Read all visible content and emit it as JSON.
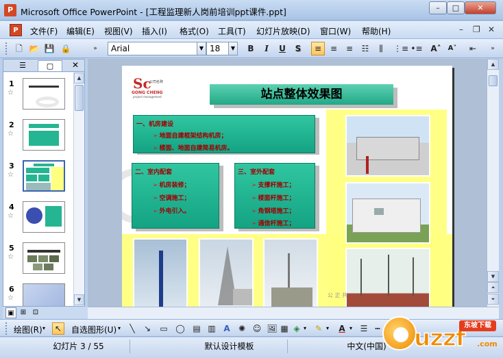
{
  "window": {
    "title": "Microsoft Office PowerPoint - [工程监理新人岗前培训ppt课件.ppt]",
    "min": "–",
    "max": "□",
    "close": "✕"
  },
  "menu": {
    "items": [
      "文件(F)",
      "编辑(E)",
      "视图(V)",
      "插入(I)",
      "格式(O)",
      "工具(T)",
      "幻灯片放映(D)",
      "窗口(W)",
      "帮助(H)"
    ],
    "ctrl_min": "–",
    "ctrl_restore": "❐",
    "ctrl_close": "✕"
  },
  "toolbar": {
    "font_name": "Arial",
    "font_size": "18",
    "bold": "B",
    "italic": "I",
    "underline": "U",
    "shadow": "S",
    "grow": "A˄",
    "shrink": "A˅"
  },
  "pane": {
    "tab_outline": "☰",
    "tab_slides": "▢",
    "close": "✕",
    "thumbs": [
      {
        "num": "1"
      },
      {
        "num": "2"
      },
      {
        "num": "3"
      },
      {
        "num": "4"
      },
      {
        "num": "5"
      },
      {
        "num": "6"
      }
    ],
    "star": "☆"
  },
  "slide": {
    "logo_sc": "Sc",
    "logo_line1": "GONG CHENG",
    "logo_line2": "project management",
    "logo_tag": "公司名称",
    "title": "站点整体效果图",
    "box1": {
      "heading": "一、机房建设",
      "items": [
        "地面自建框架结构机房；",
        "楼面、地面自建简易机房。"
      ]
    },
    "box2": {
      "heading": "二、室内配套",
      "items": [
        "机房装修；",
        "空调施工；",
        "外电引入。"
      ]
    },
    "box3": {
      "heading": "三、室外配套",
      "items": [
        "支撑杆施工；",
        "楼面杆施工；",
        "角钢塔施工；",
        "通信杆施工；"
      ]
    },
    "bullet_arrow": "➢",
    "watermark": "公 正 共"
  },
  "drawbar": {
    "draw": "绘图(R)",
    "autoshapes": "自选图形(U)"
  },
  "status": {
    "slide_info": "幻灯片 3 / 55",
    "template": "默认设计模板",
    "language": "中文(中国)"
  },
  "site_logo": {
    "brand": "uzzf",
    "tag": "东坡下载",
    "sub": ".com"
  }
}
